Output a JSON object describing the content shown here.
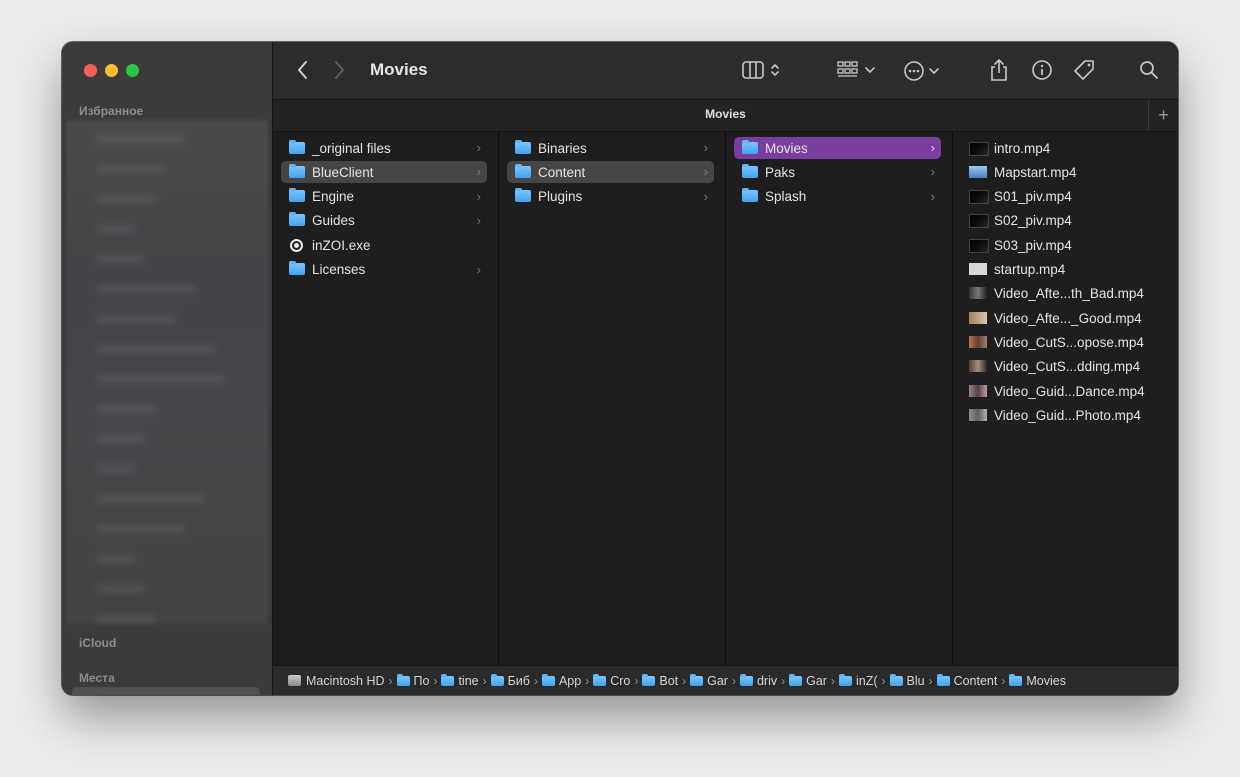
{
  "window": {
    "title": "Movies"
  },
  "sidebar": {
    "favorites_heading": "Избранное",
    "icloud_heading": "iCloud",
    "places_heading": "Места"
  },
  "toolbar": {
    "back_icon": "chevron-left",
    "forward_icon": "chevron-right",
    "view_icon": "columns-view",
    "group_icon": "grid-group",
    "action_icon": "ellipsis-circle",
    "share_icon": "share",
    "info_icon": "info-circle",
    "tag_icon": "tag",
    "search_icon": "magnifying-glass"
  },
  "tab": {
    "label": "Movies",
    "add_label": "+"
  },
  "columns": [
    {
      "items": [
        {
          "label": "_original files",
          "icon": "folder",
          "selected": "none",
          "chevron": true
        },
        {
          "label": "BlueClient",
          "icon": "folder",
          "selected": "gray",
          "chevron": true
        },
        {
          "label": "Engine",
          "icon": "folder",
          "selected": "none",
          "chevron": true
        },
        {
          "label": "Guides",
          "icon": "folder",
          "selected": "none",
          "chevron": true
        },
        {
          "label": "inZOI.exe",
          "icon": "executable",
          "selected": "none",
          "chevron": false
        },
        {
          "label": "Licenses",
          "icon": "folder",
          "selected": "none",
          "chevron": true
        }
      ]
    },
    {
      "items": [
        {
          "label": "Binaries",
          "icon": "folder",
          "selected": "none",
          "chevron": true
        },
        {
          "label": "Content",
          "icon": "folder",
          "selected": "gray",
          "chevron": true
        },
        {
          "label": "Plugins",
          "icon": "folder",
          "selected": "none",
          "chevron": true
        }
      ]
    },
    {
      "items": [
        {
          "label": "Movies",
          "icon": "folder",
          "selected": "purple",
          "chevron": true
        },
        {
          "label": "Paks",
          "icon": "folder",
          "selected": "none",
          "chevron": true
        },
        {
          "label": "Splash",
          "icon": "folder",
          "selected": "none",
          "chevron": true
        }
      ]
    },
    {
      "items": [
        {
          "label": "intro.mp4",
          "icon": "video-dark"
        },
        {
          "label": "Mapstart.mp4",
          "icon": "video-blue"
        },
        {
          "label": "S01_piv.mp4",
          "icon": "video-dark"
        },
        {
          "label": "S02_piv.mp4",
          "icon": "video-dark"
        },
        {
          "label": "S03_piv.mp4",
          "icon": "video-dark"
        },
        {
          "label": "startup.mp4",
          "icon": "video-light"
        },
        {
          "label": "Video_Afte...th_Bad.mp4",
          "icon": "video-thumb-a"
        },
        {
          "label": "Video_Afte..._Good.mp4",
          "icon": "video-thumb-b"
        },
        {
          "label": "Video_CutS...opose.mp4",
          "icon": "video-thumb-c"
        },
        {
          "label": "Video_CutS...dding.mp4",
          "icon": "video-thumb-d"
        },
        {
          "label": "Video_Guid...Dance.mp4",
          "icon": "video-thumb-e"
        },
        {
          "label": "Video_Guid...Photo.mp4",
          "icon": "video-thumb-f"
        }
      ]
    }
  ],
  "pathbar": [
    {
      "label": "Macintosh HD",
      "icon": "hard-drive"
    },
    {
      "label": "По",
      "icon": "home-folder"
    },
    {
      "label": "tine",
      "icon": "folder"
    },
    {
      "label": "Биб",
      "icon": "folder"
    },
    {
      "label": "App",
      "icon": "folder"
    },
    {
      "label": "Cro",
      "icon": "folder"
    },
    {
      "label": "Bot",
      "icon": "folder"
    },
    {
      "label": "Gar",
      "icon": "folder"
    },
    {
      "label": "driv",
      "icon": "folder"
    },
    {
      "label": "Gar",
      "icon": "folder"
    },
    {
      "label": "inZ(",
      "icon": "folder"
    },
    {
      "label": "Blu",
      "icon": "folder"
    },
    {
      "label": "Content",
      "icon": "folder"
    },
    {
      "label": "Movies",
      "icon": "folder"
    }
  ],
  "colors": {
    "selection_purple": "#7a3ea0",
    "selection_gray": "#464646",
    "folder_blue": "#3da4f3"
  }
}
